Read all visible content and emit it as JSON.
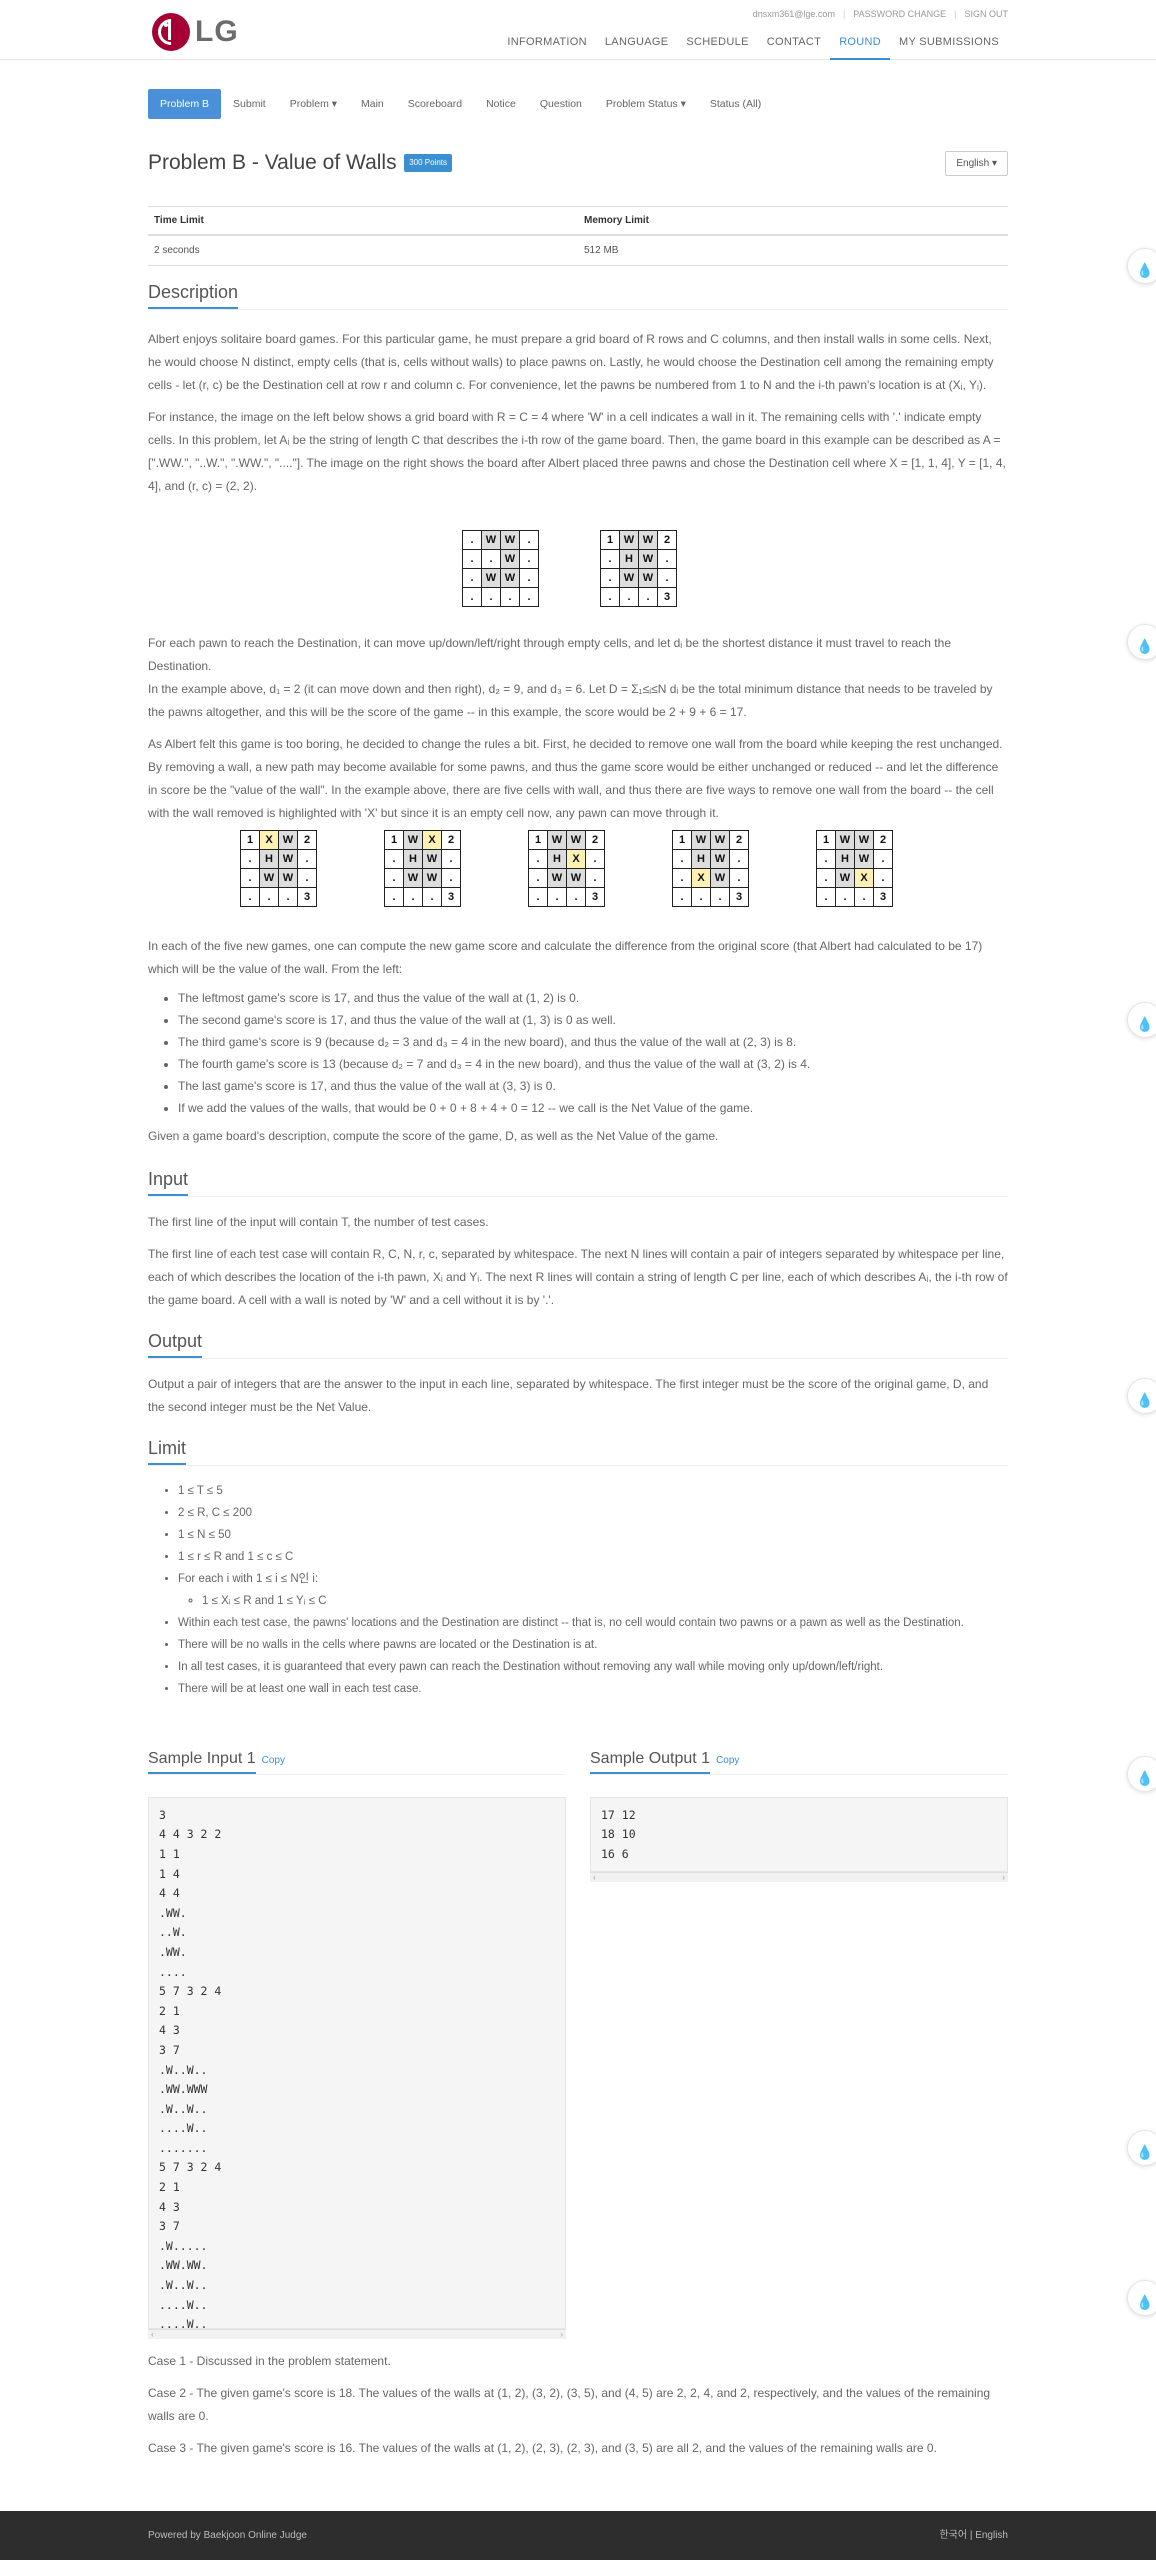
{
  "header": {
    "logo_text": "LG",
    "top_links": [
      "dnsxm361@lge.com",
      "PASSWORD CHANGE",
      "SIGN OUT"
    ],
    "nav": [
      "INFORMATION",
      "LANGUAGE",
      "SCHEDULE",
      "CONTACT",
      "ROUND",
      "MY SUBMISSIONS"
    ],
    "nav_active": "ROUND"
  },
  "tabs": [
    "Problem B",
    "Submit",
    "Problem ▾",
    "Main",
    "Scoreboard",
    "Notice",
    "Question",
    "Problem Status ▾",
    "Status (All)"
  ],
  "problem": {
    "title": "Problem B - Value of Walls",
    "points": "300 Points",
    "language_button": "English ▾",
    "time_limit_label": "Time Limit",
    "memory_limit_label": "Memory Limit",
    "time_limit": "2 seconds",
    "memory_limit": "512 MB"
  },
  "description": {
    "heading": "Description",
    "p1": "Albert enjoys solitaire board games. For this particular game, he must prepare a grid board of R rows and C columns, and then install walls in some cells. Next, he would choose N distinct, empty cells (that is, cells without walls) to place pawns on. Lastly, he would choose the Destination cell among the remaining empty cells - let (r, c) be the Destination cell at row r and column c. For convenience, let the pawns be numbered from 1 to N and the i-th pawn's location is at (Xᵢ, Yᵢ).",
    "p2": "For instance, the image on the left below shows a grid board with R = C = 4 where 'W' in a cell indicates a wall in it. The remaining cells with '.' indicate empty cells. In this problem, let Aᵢ be the string of length C that describes the i-th row of the game board. Then, the game board in this example can be described as A = [\".WW.\", \"..W.\", \".WW.\", \"....\"]. The image on the right shows the board after Albert placed three pawns and chose the Destination cell where X = [1, 1, 4], Y = [1, 4, 4], and (r, c) = (2, 2).",
    "p3": "For each pawn to reach the Destination, it can move up/down/left/right through empty cells, and let dᵢ be the shortest distance it must travel to reach the Destination.",
    "p4": "In the example above, d₁ = 2 (it can move down and then right), d₂ = 9, and d₃ = 6. Let D = Σ₁≤ᵢ≤N dᵢ be the total minimum distance that needs to be traveled by the pawns altogether, and this will be the score of the game -- in this example, the score would be 2 + 9 + 6 = 17.",
    "p5": "As Albert felt this game is too boring, he decided to change the rules a bit. First, he decided to remove one wall from the board while keeping the rest unchanged. By removing a wall, a new path may become available for some pawns, and thus the game score would be either unchanged or reduced -- and let the difference in score be the \"value of the wall\". In the example above, there are five cells with wall, and thus there are five ways to remove one wall from the board -- the cell with the wall removed is highlighted with 'X' but since it is an empty cell now, any pawn can move through it.",
    "p6": "In each of the five new games, one can compute the new game score and calculate the difference from the original score (that Albert had calculated to be 17) which will be the value of the wall. From the left:",
    "bullets": [
      "The leftmost game's score is 17, and thus the value of the wall at (1, 2) is 0.",
      "The second game's score is 17, and thus the value of the wall at (1, 3) is 0 as well.",
      "The third game's score is 9 (because d₂ = 3 and d₃ = 4 in the new board), and thus the value of the wall at (2, 3) is 8.",
      "The fourth game's score is 13 (because d₂ = 7 and d₃ = 4 in the new board), and thus the value of the wall at (3, 2) is 4.",
      "The last game's score is 17, and thus the value of the wall at (3, 3) is 0.",
      "If we add the values of the walls, that would be 0 + 0 + 8 + 4 + 0 = 12 -- we call is the Net Value of the game."
    ],
    "p7": "Given a game board's description, compute the score of the game, D, as well as the Net Value of the game."
  },
  "grids": {
    "top": [
      [
        [
          ".",
          "W",
          "W",
          "."
        ],
        [
          ".",
          ".",
          "W",
          "."
        ],
        [
          ".",
          "W",
          "W",
          "."
        ],
        [
          ".",
          ".",
          ".",
          "."
        ]
      ],
      [
        [
          "1",
          "W",
          "W",
          "2"
        ],
        [
          ".",
          "H",
          "W",
          "."
        ],
        [
          ".",
          "W",
          "W",
          "."
        ],
        [
          ".",
          ".",
          ".",
          "3"
        ]
      ]
    ],
    "bottom": [
      [
        [
          "1",
          "X",
          "W",
          "2"
        ],
        [
          ".",
          "H",
          "W",
          "."
        ],
        [
          ".",
          "W",
          "W",
          "."
        ],
        [
          ".",
          ".",
          ".",
          "3"
        ]
      ],
      [
        [
          "1",
          "W",
          "X",
          "2"
        ],
        [
          ".",
          "H",
          "W",
          "."
        ],
        [
          ".",
          "W",
          "W",
          "."
        ],
        [
          ".",
          ".",
          ".",
          "3"
        ]
      ],
      [
        [
          "1",
          "W",
          "W",
          "2"
        ],
        [
          ".",
          "H",
          "X",
          "."
        ],
        [
          ".",
          "W",
          "W",
          "."
        ],
        [
          ".",
          ".",
          ".",
          "3"
        ]
      ],
      [
        [
          "1",
          "W",
          "W",
          "2"
        ],
        [
          ".",
          "H",
          "W",
          "."
        ],
        [
          ".",
          "X",
          "W",
          "."
        ],
        [
          ".",
          ".",
          ".",
          "3"
        ]
      ],
      [
        [
          "1",
          "W",
          "W",
          "2"
        ],
        [
          ".",
          "H",
          "W",
          "."
        ],
        [
          ".",
          "W",
          "X",
          "."
        ],
        [
          ".",
          ".",
          ".",
          "3"
        ]
      ]
    ]
  },
  "input": {
    "heading": "Input",
    "p1": "The first line of the input will contain T, the number of test cases.",
    "p2": "The first line of each test case will contain R, C, N, r, c, separated by whitespace. The next N lines will contain a pair of integers separated by whitespace per line, each of which describes the location of the i-th pawn, Xᵢ and Yᵢ. The next R lines will contain a string of length C per line, each of which describes Aᵢ, the i-th row of the game board. A cell with a wall is noted by 'W' and a cell without it is by '.'."
  },
  "output": {
    "heading": "Output",
    "p1": "Output a pair of integers that are the answer to the input in each line, separated by whitespace. The first integer must be the score of the original game, D, and the second integer must be the Net Value."
  },
  "limit": {
    "heading": "Limit",
    "items": [
      "1 ≤ T ≤ 5",
      "2 ≤ R, C ≤ 200",
      "1 ≤ N ≤ 50",
      "1 ≤ r ≤ R and 1 ≤ c ≤ C",
      "For each i with 1 ≤ i ≤ N인 i:",
      "Within each test case, the pawns' locations and the Destination are distinct -- that is, no cell would contain two pawns or a pawn as well as the Destination.",
      "There will be no walls in the cells where pawns are located or the Destination is at.",
      "In all test cases, it is guaranteed that every pawn can reach the Destination without removing any wall while moving only up/down/left/right.",
      "There will be at least one wall in each test case."
    ],
    "sub_item": "1 ≤ Xᵢ ≤ R and 1 ≤ Yᵢ ≤ C"
  },
  "samples": {
    "input_heading": "Sample Input 1",
    "output_heading": "Sample Output 1",
    "copy_label": "Copy",
    "input_text": "3\n4 4 3 2 2\n1 1\n1 4\n4 4\n.WW.\n..W.\n.WW.\n....\n5 7 3 2 4\n2 1\n4 3\n3 7\n.W..W..\n.WW.WWW\n.W..W..\n....W..\n.......\n5 7 3 2 4\n2 1\n4 3\n3 7\n.W.....\n.WW.WW.\n.W..W..\n....W..\n....W..",
    "output_text": "17 12\n18 10\n16 6",
    "notes": [
      "Case 1 - Discussed in the problem statement.",
      "Case 2 - The given game's score is 18. The values of the walls at (1, 2), (3, 2), (3, 5), and (4, 5) are 2, 2, 4, and 2, respectively, and the values of the remaining walls are 0.",
      "Case 3 - The given game's score is 16. The values of the walls at (1, 2), (2, 3), (2, 3), and (3, 5) are all 2, and the values of the remaining walls are 0."
    ]
  },
  "footer": {
    "left": "Powered by Baekjoon Online Judge",
    "right": "한국어 | English"
  }
}
